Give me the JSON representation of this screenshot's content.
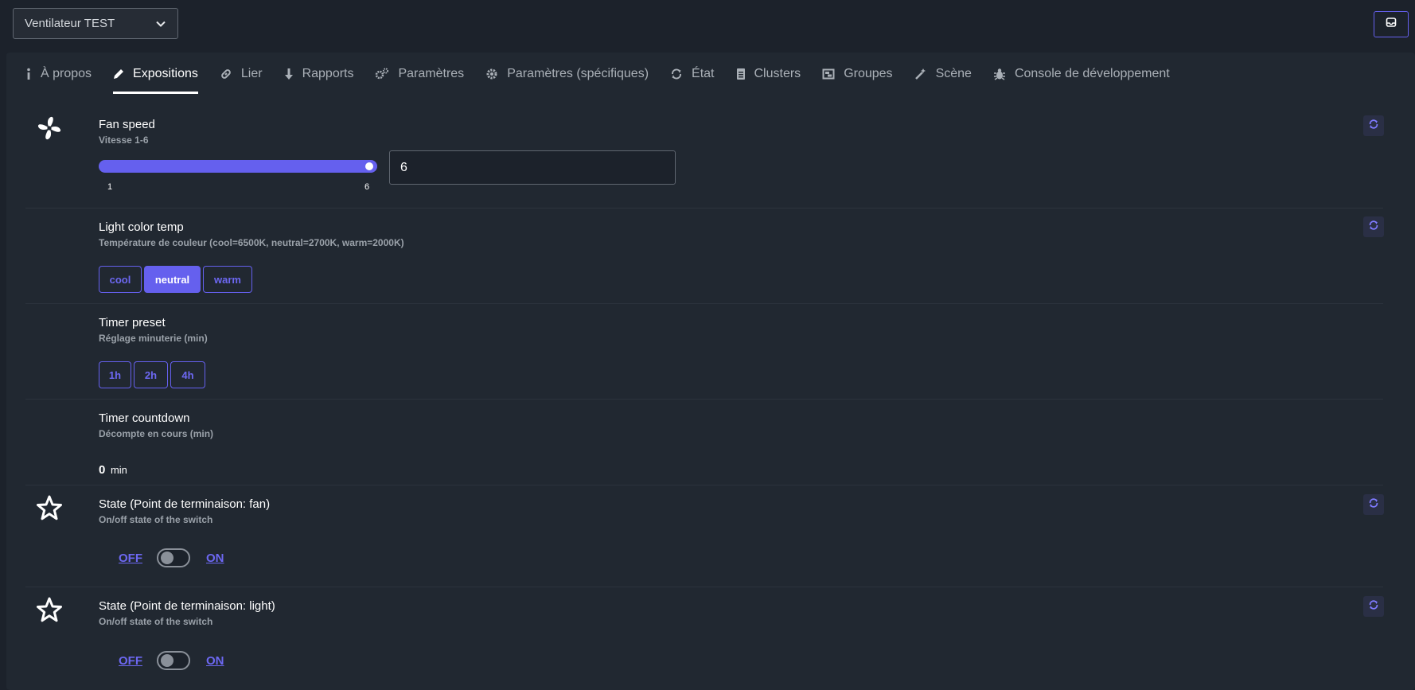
{
  "header": {
    "device_name": "Ventilateur TEST"
  },
  "tabs": [
    {
      "label": "À propos",
      "icon": "info-icon"
    },
    {
      "label": "Expositions",
      "icon": "pencil-icon",
      "active": true
    },
    {
      "label": "Lier",
      "icon": "link-icon"
    },
    {
      "label": "Rapports",
      "icon": "arrow-down-icon"
    },
    {
      "label": "Paramètres",
      "icon": "cogs-icon"
    },
    {
      "label": "Paramètres (spécifiques)",
      "icon": "gear-icon"
    },
    {
      "label": "État",
      "icon": "sync-icon"
    },
    {
      "label": "Clusters",
      "icon": "file-icon"
    },
    {
      "label": "Groupes",
      "icon": "object-group-icon"
    },
    {
      "label": "Scène",
      "icon": "magic-wand-icon"
    },
    {
      "label": "Console de développement",
      "icon": "bug-icon"
    }
  ],
  "exposes": {
    "fan_speed": {
      "title": "Fan speed",
      "description": "Vitesse 1-6",
      "min_label": "1",
      "max_label": "6",
      "value": "6",
      "level_fraction": 1.0
    },
    "light_color_temp": {
      "title": "Light color temp",
      "description": "Température de couleur (cool=6500K, neutral=2700K, warm=2000K)",
      "options": [
        "cool",
        "neutral",
        "warm"
      ],
      "selected": "neutral"
    },
    "timer_preset": {
      "title": "Timer preset",
      "description": "Réglage minuterie (min)",
      "options": [
        "1h",
        "2h",
        "4h"
      ]
    },
    "timer_countdown": {
      "title": "Timer countdown",
      "description": "Décompte en cours (min)",
      "value": "0",
      "unit": "min"
    },
    "state_fan": {
      "title": "State (Point de terminaison: fan)",
      "description": "On/off state of the switch",
      "off_label": "OFF",
      "on_label": "ON",
      "is_on": false
    },
    "state_light": {
      "title": "State (Point de terminaison: light)",
      "description": "On/off state of the switch",
      "off_label": "OFF",
      "on_label": "ON",
      "is_on": false
    }
  },
  "colors": {
    "accent": "#6560ee",
    "background": "#1c222b",
    "panel": "#212831"
  }
}
